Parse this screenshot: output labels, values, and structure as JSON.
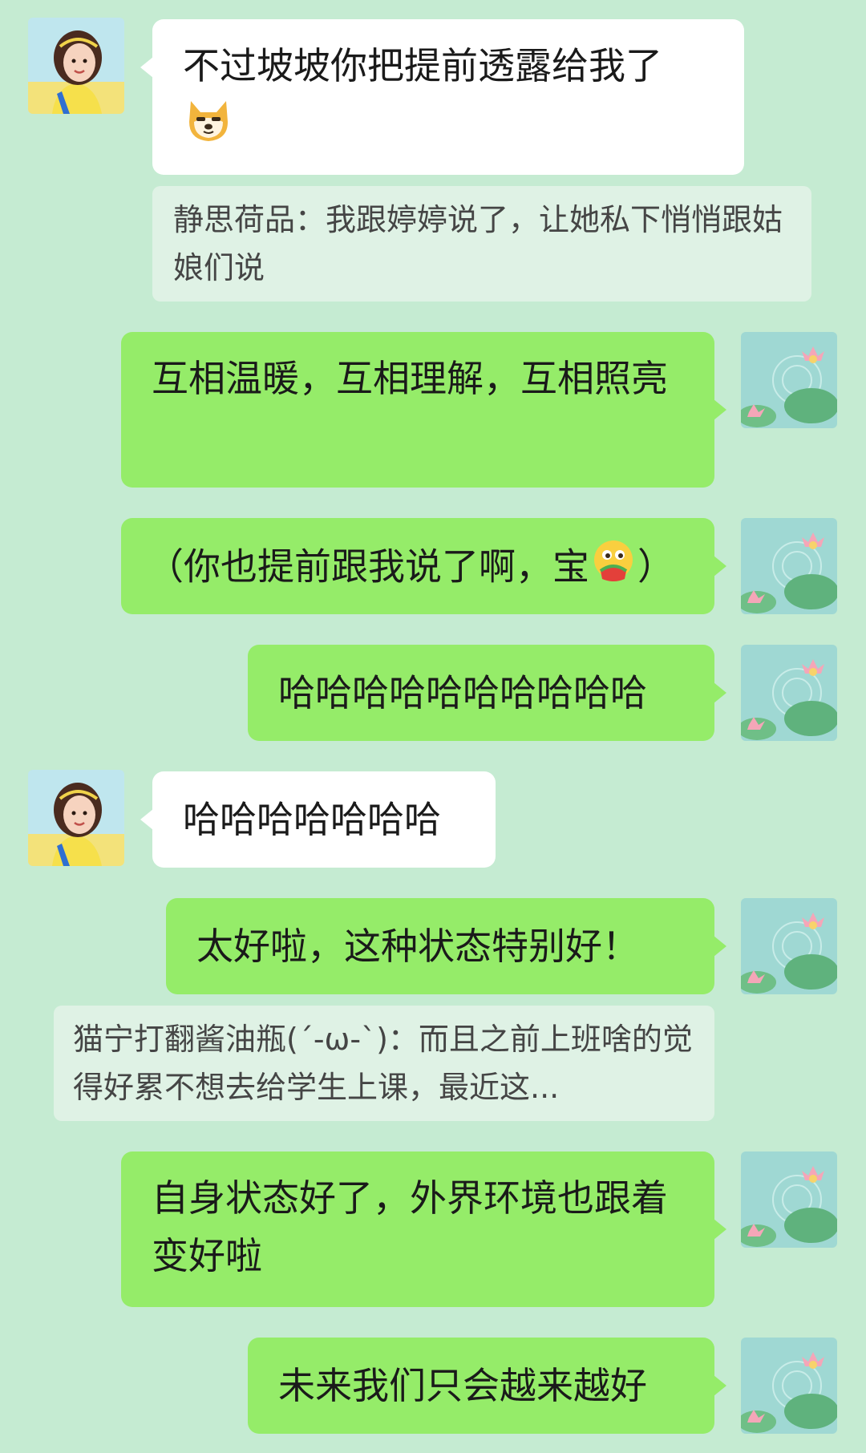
{
  "messages": [
    {
      "side": "left",
      "text": "不过坡坡你把提前透露给我了",
      "emoji": "doge-emoji"
    },
    {
      "type": "quote",
      "sender": "静思荷品",
      "text": "我跟婷婷说了，让她私下悄悄跟姑娘们说",
      "full": "静思荷品：我跟婷婷说了，让她私下悄悄跟姑娘们说"
    },
    {
      "side": "right",
      "text": "互相温暖，互相理解，互相照亮"
    },
    {
      "side": "right",
      "text_before": "（你也提前跟我说了啊，宝",
      "emoji": "eating-watermelon-emoji",
      "text_after": "）"
    },
    {
      "side": "right",
      "text": "哈哈哈哈哈哈哈哈哈哈"
    },
    {
      "side": "left",
      "text": "哈哈哈哈哈哈哈"
    },
    {
      "side": "right",
      "text": "太好啦，这种状态特别好！"
    },
    {
      "type": "quote",
      "full": "猫宁打翻酱油瓶(ˊ-ω-ˋ)：而且之前上班啥的觉得好累不想去给学生上课，最近这..."
    },
    {
      "side": "right",
      "text": "自身状态好了，外界环境也跟着变好啦"
    },
    {
      "side": "right",
      "text": "未来我们只会越来越好"
    }
  ],
  "avatars": {
    "contact": "girl-portrait-avatar",
    "self": "lotus-pond-avatar"
  },
  "colors": {
    "background": "#c5ebd2",
    "bubble_self": "#95ec69",
    "bubble_other": "#ffffff",
    "quote_bg": "#dff2e5"
  }
}
